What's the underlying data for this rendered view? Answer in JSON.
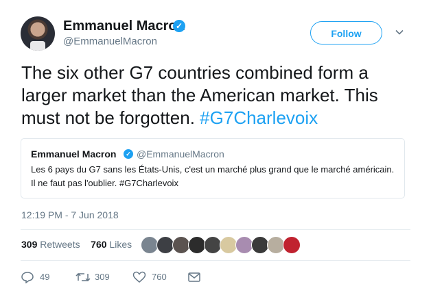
{
  "author": {
    "name": "Emmanuel Macron",
    "handle": "@EmmanuelMacron",
    "verified": true
  },
  "follow_label": "Follow",
  "tweet": {
    "text": "The six other G7 countries combined form a larger market than the American market. This must not be forgotten.",
    "hashtag": "#G7Charlevoix"
  },
  "quoted": {
    "name": "Emmanuel Macron",
    "handle": "@EmmanuelMacron",
    "text": "Les 6 pays du G7 sans les États-Unis, c'est un marché plus grand que le marché américain. Il ne faut pas l'oublier. #G7Charlevoix"
  },
  "timestamp": "12:19 PM - 7 Jun 2018",
  "stats": {
    "retweets_count": "309",
    "retweets_label": "Retweets",
    "likes_count": "760",
    "likes_label": "Likes"
  },
  "actions": {
    "reply_count": "49",
    "retweet_count": "309",
    "like_count": "760"
  },
  "colors": {
    "accent": "#1da1f2",
    "text": "#14171a",
    "muted": "#657786"
  },
  "liker_avatars": [
    "#7a8590",
    "#3d3f44",
    "#5b5350",
    "#2c2c2c",
    "#444",
    "#d8c9a0",
    "#a88cb0",
    "#3a3a3a",
    "#b7ae9f",
    "#c0222f"
  ]
}
